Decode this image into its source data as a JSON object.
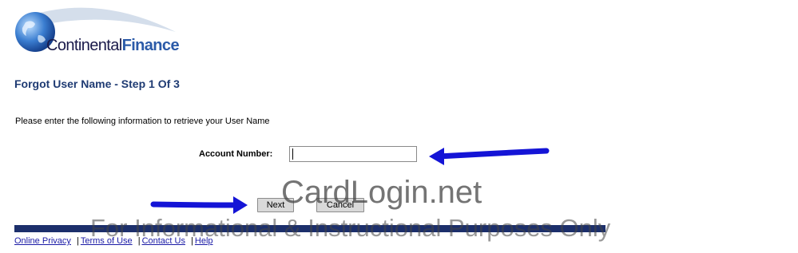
{
  "logo": {
    "part1": "Continental",
    "part2": "Finance"
  },
  "page": {
    "step_title": "Forgot User Name - Step 1 Of 3",
    "instructions": "Please enter the following information to retrieve your User Name"
  },
  "form": {
    "account_label": "Account Number:",
    "account_value": ""
  },
  "buttons": {
    "next": "Next",
    "cancel": "Cancel"
  },
  "footer": {
    "links": [
      "Online Privacy",
      "Terms of Use",
      "Contact Us",
      "Help"
    ],
    "separator": "|"
  },
  "watermark": {
    "main": "CardLogin.net",
    "sub": "For Informational & Instructional Purposes Only"
  },
  "colors": {
    "title": "#1f3b73",
    "bar": "#1c2f6b",
    "link": "#1a1aa6",
    "arrow": "#1414d6"
  }
}
